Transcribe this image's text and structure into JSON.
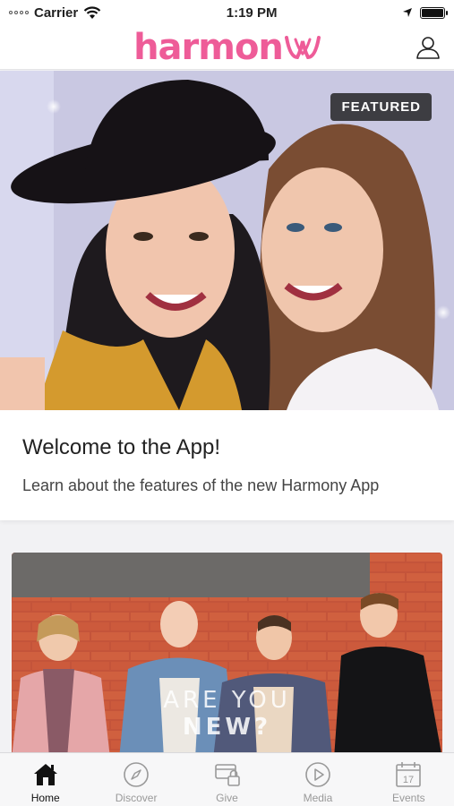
{
  "status_bar": {
    "carrier": "Carrier",
    "time": "1:19 PM",
    "battery_level": 1.0
  },
  "header": {
    "logo_text": "harmon",
    "brand_color": "#ee5c98",
    "profile_icon": "user-icon"
  },
  "featured": {
    "badge": "FEATURED",
    "title": "Welcome to the App!",
    "subtitle": "Learn about the features of the new Harmony App"
  },
  "promo": {
    "line1": "ARE YOU",
    "line2": "NEW?"
  },
  "tabs": [
    {
      "label": "Home",
      "icon": "home-icon",
      "active": true
    },
    {
      "label": "Discover",
      "icon": "compass-icon",
      "active": false
    },
    {
      "label": "Give",
      "icon": "give-icon",
      "active": false
    },
    {
      "label": "Media",
      "icon": "play-icon",
      "active": false
    },
    {
      "label": "Events",
      "icon": "calendar-icon",
      "active": false
    }
  ]
}
